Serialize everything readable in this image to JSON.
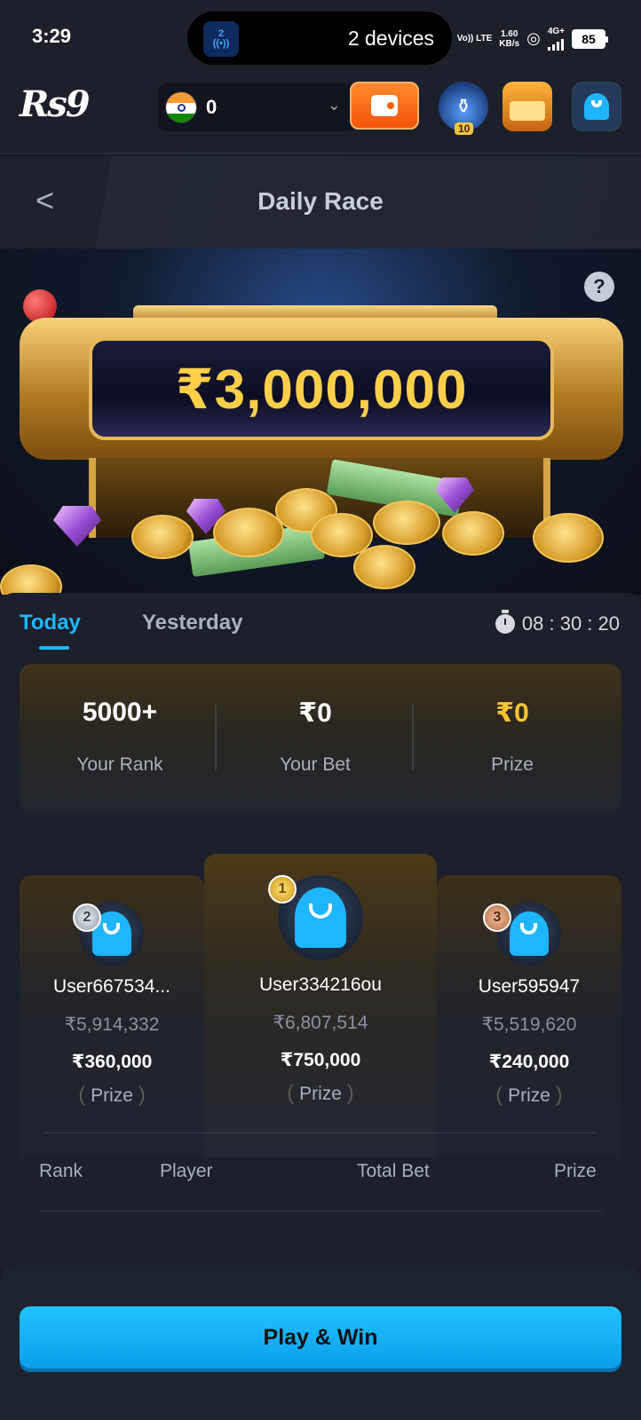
{
  "status_bar": {
    "time": "3:29",
    "island_badge": "2",
    "island_text": "2 devices",
    "network_line1": "Vo)) LTE",
    "speed_value": "1.60",
    "speed_unit": "KB/s",
    "network_type": "4G+",
    "battery": "85"
  },
  "header": {
    "logo": "Rs9",
    "balance": "0",
    "jar_badge": "10"
  },
  "title_bar": {
    "title": "Daily Race"
  },
  "banner": {
    "jackpot": "₹3,000,000",
    "help": "?"
  },
  "tabs": {
    "today": "Today",
    "yesterday": "Yesterday",
    "timer": "08 : 30 : 20"
  },
  "my_stats": {
    "rank_value": "5000+",
    "rank_label": "Your Rank",
    "bet_value": "₹0",
    "bet_label": "Your Bet",
    "prize_value": "₹0",
    "prize_label": "Prize"
  },
  "podium": {
    "first": {
      "medal": "1",
      "name": "User334216ou",
      "bet": "₹6,807,514",
      "prize": "₹750,000",
      "prize_label": "Prize"
    },
    "second": {
      "medal": "2",
      "name": "User667534...",
      "bet": "₹5,914,332",
      "prize": "₹360,000",
      "prize_label": "Prize"
    },
    "third": {
      "medal": "3",
      "name": "User595947",
      "bet": "₹5,519,620",
      "prize": "₹240,000",
      "prize_label": "Prize"
    }
  },
  "leaderboard": {
    "columns": [
      "Rank",
      "Player",
      "Total Bet",
      "Prize"
    ]
  },
  "cta": {
    "label": "Play & Win"
  },
  "colors": {
    "accent": "#1fb6ff",
    "prize_gold": "#ffc531",
    "background": "#1b202b",
    "wallet_orange": "#f2540a"
  }
}
